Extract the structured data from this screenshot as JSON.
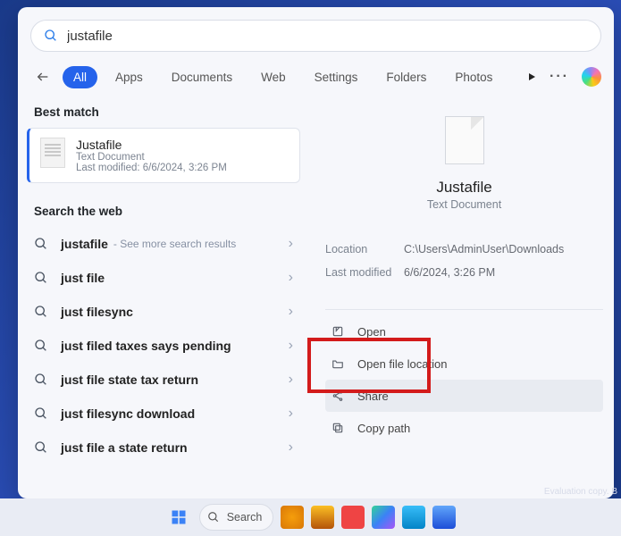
{
  "search": {
    "value": "justafile"
  },
  "tabs": {
    "all": "All",
    "apps": "Apps",
    "documents": "Documents",
    "web": "Web",
    "settings": "Settings",
    "folders": "Folders",
    "photos": "Photos"
  },
  "sections": {
    "best": "Best match",
    "web": "Search the web"
  },
  "bestmatch": {
    "name": "Justafile",
    "type": "Text Document",
    "modified": "Last modified: 6/6/2024, 3:26 PM"
  },
  "websuggest": [
    {
      "text": "justafile",
      "hint": "- See more search results"
    },
    {
      "text": "just file",
      "hint": ""
    },
    {
      "text": "just filesync",
      "hint": ""
    },
    {
      "text": "just filed taxes says pending",
      "hint": ""
    },
    {
      "text": "just file state tax return",
      "hint": ""
    },
    {
      "text": "just filesync download",
      "hint": ""
    },
    {
      "text": "just file a state return",
      "hint": ""
    }
  ],
  "preview": {
    "title": "Justafile",
    "subtitle": "Text Document",
    "meta": {
      "locationLabel": "Location",
      "locationVal": "C:\\Users\\AdminUser\\Downloads",
      "modifiedLabel": "Last modified",
      "modifiedVal": "6/6/2024, 3:26 PM"
    },
    "actions": {
      "open": "Open",
      "openloc": "Open file location",
      "share": "Share",
      "copypath": "Copy path"
    }
  },
  "taskbar": {
    "searchLabel": "Search"
  },
  "watermark": "Evaluation copy. B"
}
